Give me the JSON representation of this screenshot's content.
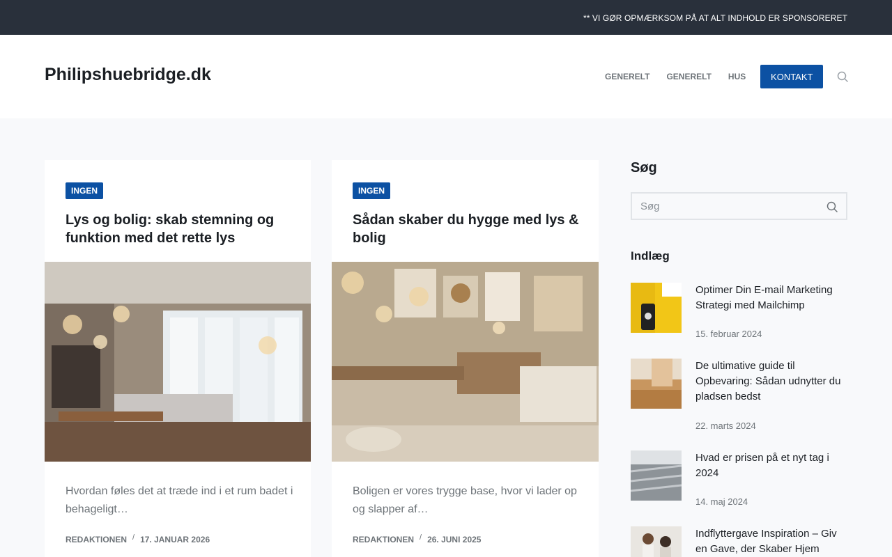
{
  "topbar": {
    "notice": "** VI GØR OPMÆRKSOM PÅ AT ALT INDHOLD ER SPONSORERET"
  },
  "header": {
    "logo": "Philipshuebridge.dk",
    "nav": [
      {
        "label": "GENERELT"
      },
      {
        "label": "GENERELT"
      },
      {
        "label": "HUS"
      }
    ],
    "cta": "KONTAKT",
    "search_icon": "search-icon"
  },
  "cards": [
    {
      "badge": "INGEN",
      "title": "Lys og bolig: skab stemning og funktion med det rette lys",
      "excerpt": "Hvordan føles det at træde ind i et rum badet i behageligt…",
      "author": "REDAKTIONEN",
      "date": "17. JANUAR 2026"
    },
    {
      "badge": "INGEN",
      "title": "Sådan skaber du hygge med lys & bolig",
      "excerpt": "Boligen er vores trygge base, hvor vi lader op og slapper af…",
      "author": "REDAKTIONEN",
      "date": "26. JUNI 2025"
    }
  ],
  "sidebar": {
    "search_heading": "Søg",
    "search_placeholder": "Søg",
    "posts_heading": "Indlæg",
    "posts": [
      {
        "title": "Optimer Din E-mail Marketing Strategi med Mailchimp",
        "date": "15. februar 2024"
      },
      {
        "title": "De ultimative guide til Opbevaring: Sådan udnytter du pladsen bedst",
        "date": "22. marts 2024"
      },
      {
        "title": "Hvad er prisen på et nyt tag i 2024",
        "date": "14. maj 2024"
      },
      {
        "title": "Indflyttergave Inspiration – Giv en Gave, der Skaber Hjem",
        "date": ""
      }
    ]
  },
  "colors": {
    "accent": "#0c51a3",
    "topbar": "#29303b",
    "background": "#f8f9fb"
  }
}
